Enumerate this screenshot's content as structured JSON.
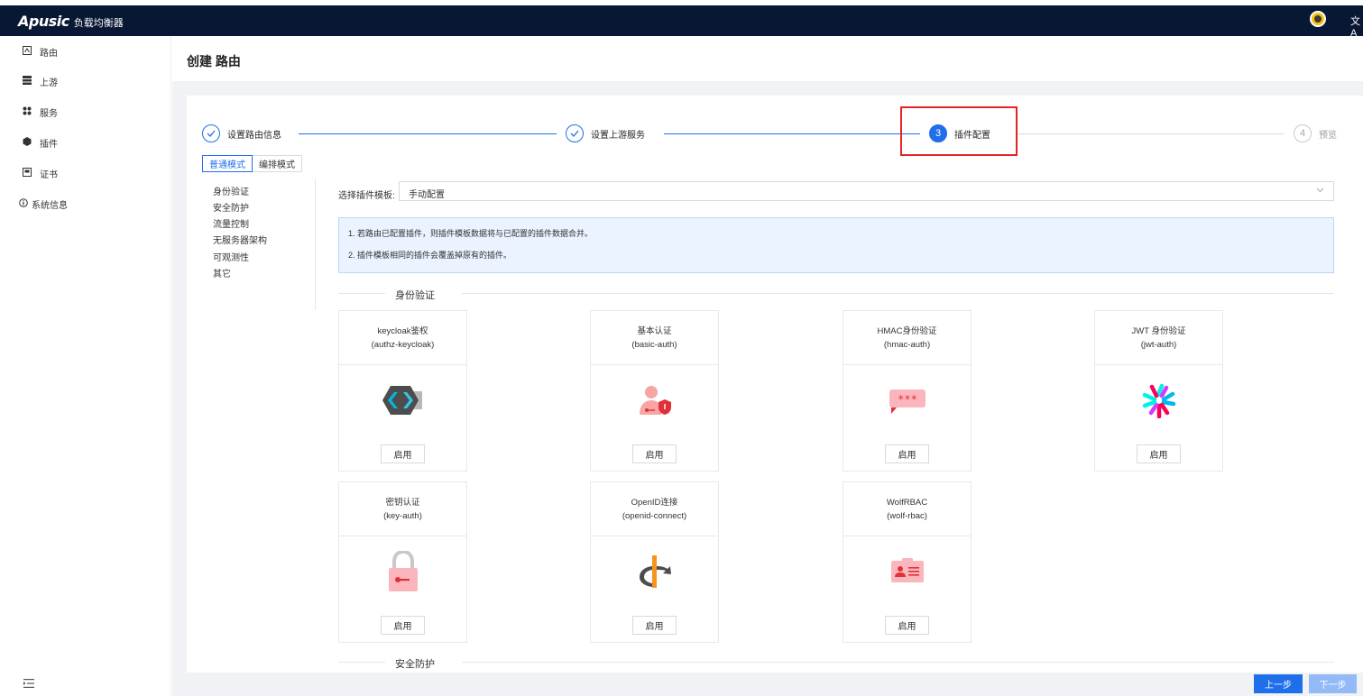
{
  "app": {
    "brand_logo": "Apusic",
    "brand_name": "负载均衡器",
    "lang_icon": "文A"
  },
  "sidebar": {
    "items": [
      {
        "label": "路由",
        "icon": "route-icon"
      },
      {
        "label": "上游",
        "icon": "upstream-icon"
      },
      {
        "label": "服务",
        "icon": "service-icon"
      },
      {
        "label": "插件",
        "icon": "plugin-icon"
      },
      {
        "label": "证书",
        "icon": "certificate-icon"
      },
      {
        "label": "系统信息",
        "icon": "info-icon"
      }
    ],
    "collapse_icon": "menu-collapse-icon"
  },
  "page": {
    "title": "创建 路由"
  },
  "steps": [
    {
      "label": "设置路由信息",
      "state": "done"
    },
    {
      "label": "设置上游服务",
      "state": "done"
    },
    {
      "number": "3",
      "label": "插件配置",
      "state": "active"
    },
    {
      "number": "4",
      "label": "预览",
      "state": "wait"
    }
  ],
  "mode_tabs": [
    "普通模式",
    "编排模式"
  ],
  "categories": [
    "身份验证",
    "安全防护",
    "流量控制",
    "无服务器架构",
    "可观测性",
    "其它"
  ],
  "template": {
    "label": "选择插件模板:",
    "value": "手动配置"
  },
  "info": [
    "1. 若路由已配置插件，则插件模板数据将与已配置的插件数据合并。",
    "2. 插件模板相同的插件会覆盖掉原有的插件。"
  ],
  "sections": {
    "auth": "身份验证",
    "security": "安全防护"
  },
  "plugins": [
    {
      "name": "keycloak鉴权",
      "id": "(authz-keycloak)",
      "button": "启用",
      "icon": "keycloak-icon"
    },
    {
      "name": "基本认证",
      "id": "(basic-auth)",
      "button": "启用",
      "icon": "basic-auth-icon"
    },
    {
      "name": "HMAC身份验证",
      "id": "(hmac-auth)",
      "button": "启用",
      "icon": "hmac-icon"
    },
    {
      "name": "JWT 身份验证",
      "id": "(jwt-auth)",
      "button": "启用",
      "icon": "jwt-icon"
    },
    {
      "name": "密钥认证",
      "id": "(key-auth)",
      "button": "启用",
      "icon": "key-auth-icon"
    },
    {
      "name": "OpenID连接",
      "id": "(openid-connect)",
      "button": "启用",
      "icon": "openid-icon"
    },
    {
      "name": "WolfRBAC",
      "id": "(wolf-rbac)",
      "button": "启用",
      "icon": "wolf-rbac-icon"
    }
  ],
  "footer": {
    "prev": "上一步",
    "next": "下一步"
  },
  "colors": {
    "topbar": "#081734",
    "primary": "#1f6feb",
    "highlight": "#e52222"
  }
}
